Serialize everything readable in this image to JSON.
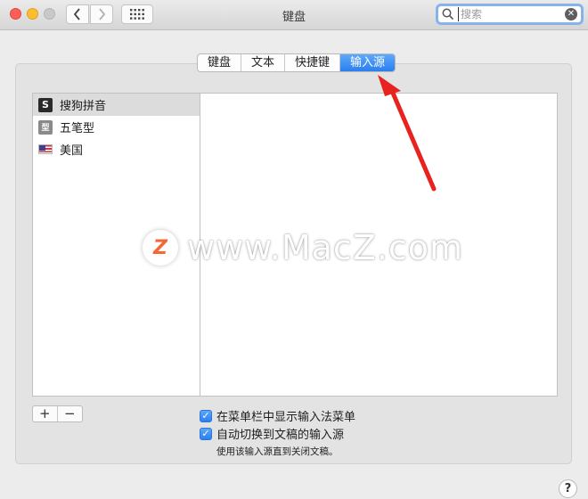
{
  "window": {
    "title": "键盘",
    "back_icon": "chevron-left-icon",
    "forward_icon": "chevron-right-icon",
    "show_all_icon": "grid-icon"
  },
  "search": {
    "placeholder": "搜索",
    "value": ""
  },
  "tabs": [
    {
      "label": "键盘",
      "active": false
    },
    {
      "label": "文本",
      "active": false
    },
    {
      "label": "快捷键",
      "active": false
    },
    {
      "label": "输入源",
      "active": true
    }
  ],
  "input_sources": [
    {
      "label": "搜狗拼音",
      "icon": "sogou-icon",
      "icon_glyph": "S",
      "selected": true
    },
    {
      "label": "五笔型",
      "icon": "wubi-icon",
      "icon_glyph": "型",
      "selected": false
    },
    {
      "label": "美国",
      "icon": "us-flag-icon",
      "icon_glyph": "",
      "selected": false
    }
  ],
  "list_controls": {
    "add": "+",
    "remove": "−"
  },
  "options": {
    "show_menu_label": "在菜单栏中显示输入法菜单",
    "show_menu_checked": true,
    "auto_switch_label": "自动切换到文稿的输入源",
    "auto_switch_checked": true,
    "note": "使用该输入源直到关闭文稿。"
  },
  "help": "?",
  "watermark": {
    "logo": "Z",
    "text": "www.MacZ.com"
  },
  "colors": {
    "accent": "#2b7ef0",
    "arrow": "#e8231f"
  }
}
